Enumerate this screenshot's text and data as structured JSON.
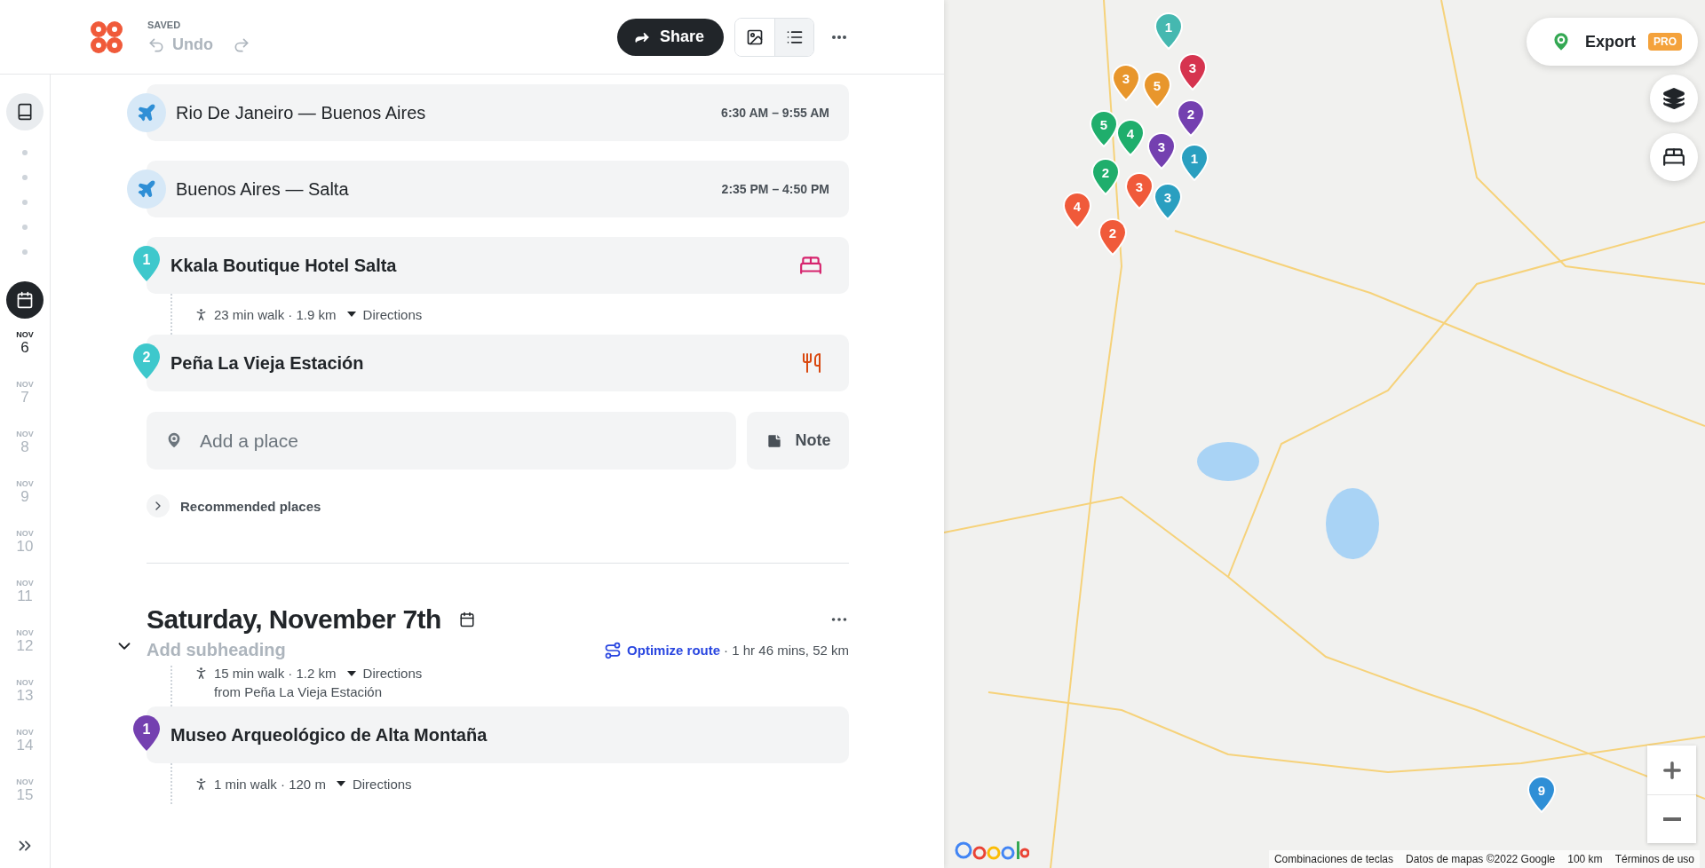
{
  "header": {
    "status": "SAVED",
    "undo": "Undo",
    "share": "Share",
    "views": [
      {
        "kind": "image",
        "selected": false
      },
      {
        "kind": "list",
        "selected": true
      }
    ]
  },
  "sidebar": {
    "days": [
      {
        "month": "NOV",
        "day": "6",
        "selected": true
      },
      {
        "month": "NOV",
        "day": "7",
        "selected": false
      },
      {
        "month": "NOV",
        "day": "8",
        "selected": false
      },
      {
        "month": "NOV",
        "day": "9",
        "selected": false
      },
      {
        "month": "NOV",
        "day": "10",
        "selected": false
      },
      {
        "month": "NOV",
        "day": "11",
        "selected": false
      },
      {
        "month": "NOV",
        "day": "12",
        "selected": false
      },
      {
        "month": "NOV",
        "day": "13",
        "selected": false
      },
      {
        "month": "NOV",
        "day": "14",
        "selected": false
      },
      {
        "month": "NOV",
        "day": "15",
        "selected": false
      }
    ]
  },
  "day_one": {
    "items": [
      {
        "kind": "flight",
        "route": "Rio De Janeiro — Buenos Aires",
        "time": "6:30 AM – 9:55 AM"
      },
      {
        "kind": "flight",
        "route": "Buenos Aires — Salta",
        "time": "2:35 PM – 4:50 PM"
      },
      {
        "kind": "hotel",
        "number": "1",
        "name": "Kkala Boutique Hotel Salta",
        "color": "#3ec8cc"
      },
      {
        "kind": "walk",
        "text": "23 min walk · 1.9 km",
        "link": "Directions"
      },
      {
        "kind": "restaurant",
        "number": "2",
        "name": "Peña La Vieja Estación",
        "color": "#3ec8cc"
      }
    ],
    "add_place": {
      "placeholder": "Add a place"
    },
    "note": "Note",
    "recommended": "Recommended places"
  },
  "day_two": {
    "title": "Saturday, November 7th",
    "subheading": {
      "placeholder": "Add subheading"
    },
    "optimize": "Optimize route",
    "summary": "· 1 hr 46 mins, 52 km",
    "items": [
      {
        "kind": "walk",
        "text": "15 min walk · 1.2 km",
        "link": "Directions",
        "from": "from Peña La Vieja Estación"
      },
      {
        "kind": "place",
        "number": "1",
        "name": "Museo Arqueológico de Alta Montaña",
        "color": "#7440b0"
      },
      {
        "kind": "walk",
        "text": "1 min walk · 120 m",
        "link": "Directions"
      }
    ]
  },
  "map": {
    "export": "Export",
    "badge": "PRO",
    "pins": [
      {
        "number": "1",
        "color": "#45b8b0"
      },
      {
        "number": "3",
        "color": "#d6344f"
      },
      {
        "number": "3",
        "color": "#e8962c"
      },
      {
        "number": "5",
        "color": "#e8962c"
      },
      {
        "number": "2",
        "color": "#7440b0"
      },
      {
        "number": "5",
        "color": "#1fae6c"
      },
      {
        "number": "4",
        "color": "#1fae6c"
      },
      {
        "number": "3",
        "color": "#7440b0"
      },
      {
        "number": "1",
        "color": "#2a9fc0"
      },
      {
        "number": "2",
        "color": "#1fae6c"
      },
      {
        "number": "4",
        "color": "#f05a3a"
      },
      {
        "number": "3",
        "color": "#f05a3a"
      },
      {
        "number": "3",
        "color": "#2a9fc0"
      },
      {
        "number": "2",
        "color": "#f05a3a"
      },
      {
        "number": "9",
        "color": "#2f8fd6"
      }
    ],
    "attribution": [
      "Combinaciones de teclas",
      "Datos de mapas ©2022 Google",
      "100 km",
      "Términos de uso"
    ]
  }
}
